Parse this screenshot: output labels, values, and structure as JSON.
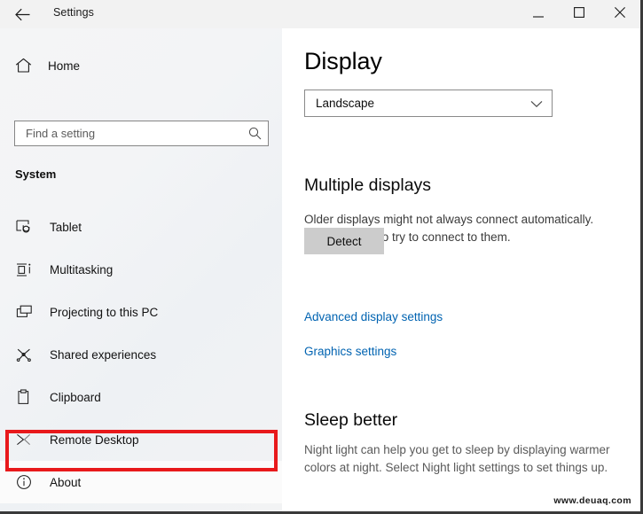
{
  "window": {
    "title": "Settings",
    "back_icon": "back-arrow-icon",
    "controls": {
      "minimize": "minimize-icon",
      "maximize": "maximize-icon",
      "close": "close-icon"
    }
  },
  "sidebar": {
    "home": {
      "label": "Home",
      "icon": "home-icon"
    },
    "search": {
      "placeholder": "Find a setting",
      "value": "",
      "icon": "search-icon"
    },
    "section_header": "System",
    "items": [
      {
        "label": "Tablet",
        "icon": "tablet-icon",
        "selected": false
      },
      {
        "label": "Multitasking",
        "icon": "multitasking-icon",
        "selected": false
      },
      {
        "label": "Projecting to this PC",
        "icon": "projecting-icon",
        "selected": false
      },
      {
        "label": "Shared experiences",
        "icon": "shared-experiences-icon",
        "selected": false
      },
      {
        "label": "Clipboard",
        "icon": "clipboard-icon",
        "selected": false
      },
      {
        "label": "Remote Desktop",
        "icon": "remote-desktop-icon",
        "selected": false
      },
      {
        "label": "About",
        "icon": "info-icon",
        "selected": true
      }
    ],
    "highlight": {
      "target": "About",
      "color": "#e8191b"
    }
  },
  "content": {
    "page_title": "Display",
    "orientation_dropdown": {
      "value": "Landscape",
      "chevron_icon": "chevron-down-icon"
    },
    "multiple_displays": {
      "heading": "Multiple displays",
      "description": "Older displays might not always connect automatically. Select Detect to try to connect to them.",
      "detect_button": "Detect",
      "links": [
        "Advanced display settings",
        "Graphics settings"
      ]
    },
    "sleep_better": {
      "heading": "Sleep better",
      "description": "Night light can help you get to sleep by displaying warmer colors at night. Select Night light settings to set things up."
    }
  },
  "watermark": "www.deuaq.com"
}
